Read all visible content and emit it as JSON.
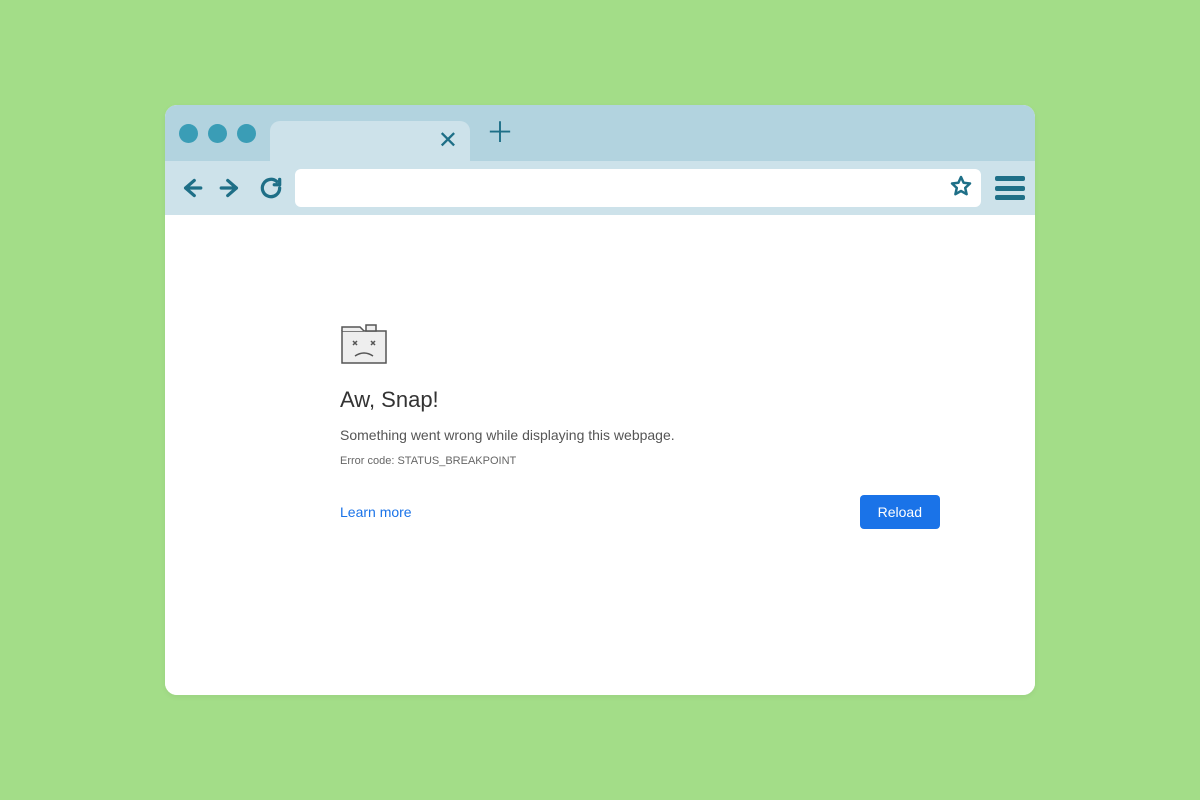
{
  "error_page": {
    "title": "Aw, Snap!",
    "description": "Something went wrong while displaying this webpage.",
    "error_code": "Error code: STATUS_BREAKPOINT",
    "learn_more": "Learn more",
    "reload_button": "Reload"
  }
}
